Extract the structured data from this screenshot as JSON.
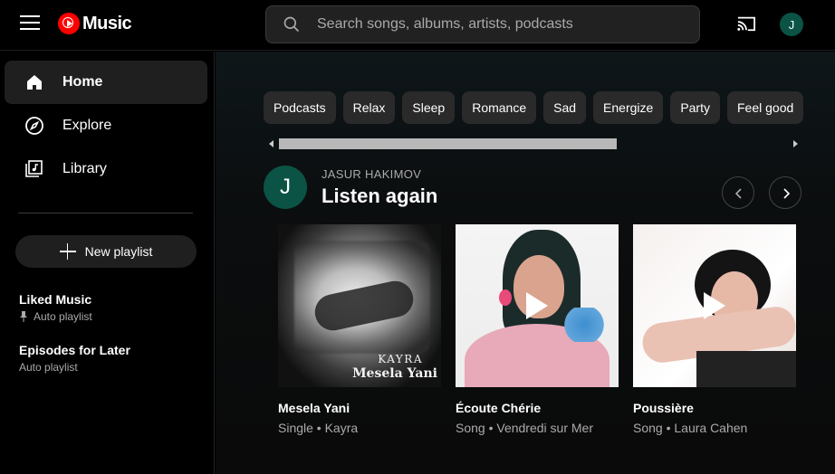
{
  "app": {
    "logo_text": "Music"
  },
  "search": {
    "placeholder": "Search songs, albums, artists, podcasts"
  },
  "user": {
    "initial": "J"
  },
  "sidebar": {
    "nav": [
      {
        "label": "Home",
        "icon": "home-icon",
        "active": true
      },
      {
        "label": "Explore",
        "icon": "compass-icon",
        "active": false
      },
      {
        "label": "Library",
        "icon": "library-icon",
        "active": false
      }
    ],
    "new_playlist_label": "New playlist",
    "playlists": [
      {
        "title": "Liked Music",
        "subtitle": "Auto playlist",
        "pinned": true
      },
      {
        "title": "Episodes for Later",
        "subtitle": "Auto playlist",
        "pinned": false
      }
    ]
  },
  "chips": [
    "Podcasts",
    "Relax",
    "Sleep",
    "Romance",
    "Sad",
    "Energize",
    "Party",
    "Feel good"
  ],
  "shelf": {
    "user_name": "JASUR HAKIMOV",
    "title": "Listen again",
    "items": [
      {
        "title": "Mesela Yani",
        "subtitle": "Single • Kayra",
        "art_text_1": "KAYRA",
        "art_text_2": "Mesela Yani"
      },
      {
        "title": "Écoute Chérie",
        "subtitle": "Song • Vendredi sur Mer"
      },
      {
        "title": "Poussière",
        "subtitle": "Song • Laura Cahen"
      }
    ]
  },
  "colors": {
    "accent_red": "#ff0000",
    "avatar_green": "#0b5345",
    "background": "#000000",
    "chip_bg": "#2a2a2a"
  }
}
